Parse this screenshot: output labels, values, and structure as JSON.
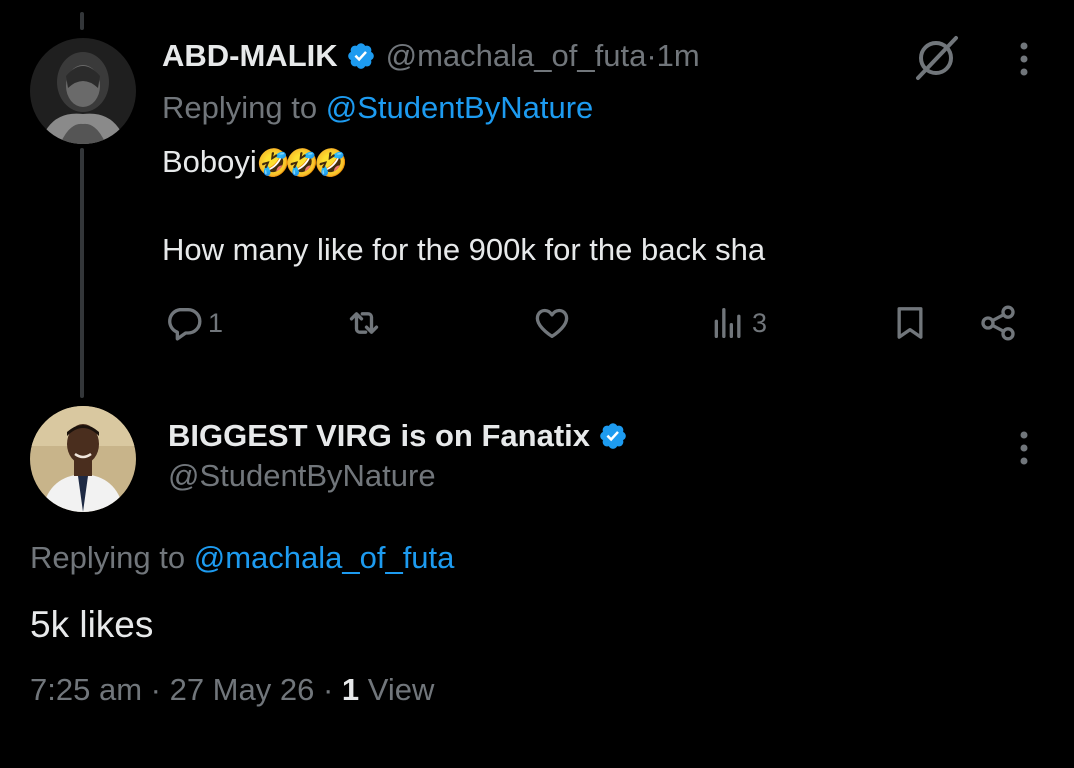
{
  "reply_tweet": {
    "author_name": "ABD-MALIK",
    "handle": "@machala_of_futa",
    "separator": " · ",
    "time_ago": "1m",
    "replying_to_label": "Replying to ",
    "replying_to_handle": "@StudentByNature",
    "text_line_1": "Boboyi",
    "text_emojis": "🤣🤣🤣",
    "text_line_2": "How many like for the 900k for the back sha",
    "actions": {
      "reply_count": "1",
      "retweet_count": "",
      "like_count": "",
      "views_count": "3"
    }
  },
  "main_tweet": {
    "author_name": "BIGGEST VIRG is on Fanatix",
    "handle": "@StudentByNature",
    "replying_to_label": "Replying to ",
    "replying_to_handle": "@machala_of_futa",
    "text": "5k likes",
    "time": "7:25 am",
    "sep1": " · ",
    "date": "27 May 26",
    "sep2": " · ",
    "views_count": "1",
    "views_label": " View"
  },
  "colors": {
    "background": "#000000",
    "text": "#e7e9ea",
    "muted": "#71767b",
    "link": "#1d9bf0",
    "verified": "#1d9bf0",
    "thread_line": "#333639"
  },
  "icons": {
    "verified": "verified-badge-icon",
    "grok": "grok-icon",
    "more": "more-options-icon",
    "reply": "reply-icon",
    "retweet": "retweet-icon",
    "like": "heart-icon",
    "views": "views-icon",
    "bookmark": "bookmark-icon",
    "share": "share-icon"
  }
}
